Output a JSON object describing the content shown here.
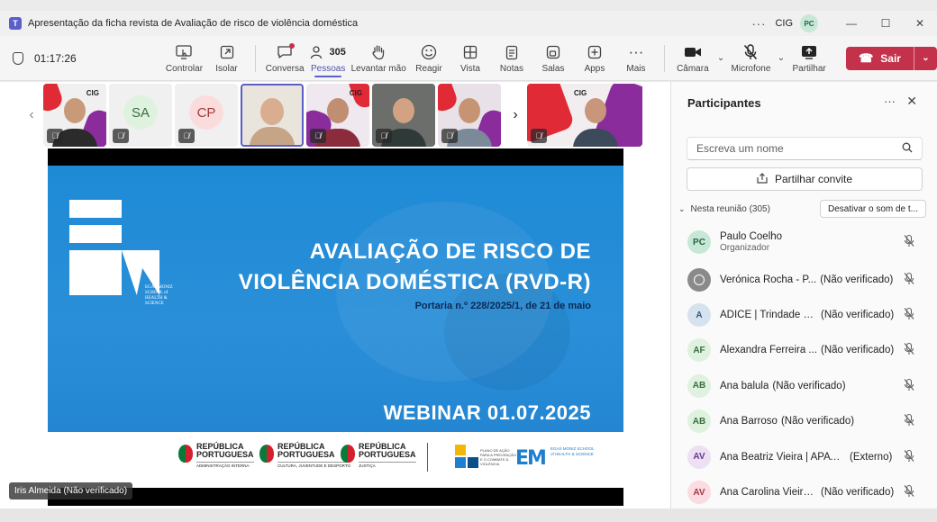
{
  "window": {
    "title": "Apresentação da ficha revista de Avaliação de risco de violência doméstica",
    "org": "CIG",
    "avatar_initials": "PC",
    "more_icon": "ellipsis-icon",
    "controls": [
      "minimize-icon",
      "maximize-icon",
      "close-icon"
    ]
  },
  "toolbar": {
    "timer": "01:17:26",
    "items": [
      {
        "name": "controlar",
        "label": "Controlar",
        "icon": "share-screen-control-icon"
      },
      {
        "name": "isolar",
        "label": "Isolar",
        "icon": "pop-out-icon"
      },
      {
        "name": "conversa",
        "label": "Conversa",
        "icon": "chat-icon"
      },
      {
        "name": "pessoas",
        "label": "Pessoas",
        "icon": "people-icon",
        "count": "305",
        "active": true
      },
      {
        "name": "levantar-mao",
        "label": "Levantar mão",
        "icon": "raise-hand-icon"
      },
      {
        "name": "reagir",
        "label": "Reagir",
        "icon": "smile-icon"
      },
      {
        "name": "vista",
        "label": "Vista",
        "icon": "grid-view-icon"
      },
      {
        "name": "notas",
        "label": "Notas",
        "icon": "notes-icon"
      },
      {
        "name": "salas",
        "label": "Salas",
        "icon": "breakout-rooms-icon"
      },
      {
        "name": "apps",
        "label": "Apps",
        "icon": "apps-plus-icon"
      },
      {
        "name": "mais",
        "label": "Mais",
        "icon": "more-icon"
      }
    ],
    "camera_label": "Câmara",
    "mic_label": "Microfone",
    "share_label": "Partilhar",
    "leave_label": "Sair"
  },
  "strip": {
    "tiles": [
      {
        "type": "video",
        "brand": "CIG",
        "muted": true
      },
      {
        "type": "initials",
        "initials": "SA",
        "bg": "#dff2e0",
        "fg": "#3b6e3f",
        "muted": true
      },
      {
        "type": "initials",
        "initials": "CP",
        "bg": "#fbdcdc",
        "fg": "#a33a3a",
        "muted": true
      },
      {
        "type": "video",
        "selected": true,
        "muted": false
      },
      {
        "type": "video",
        "brand": "CIG",
        "muted": true
      },
      {
        "type": "video",
        "muted": true
      },
      {
        "type": "video",
        "muted": true
      },
      {
        "type": "video",
        "brand": "CIG",
        "muted": true,
        "wide": true
      }
    ]
  },
  "slide": {
    "title_line1": "AVALIAÇÃO DE RISCO DE",
    "title_line2": "VIOLÊNCIA DOMÉSTICA (RVD-R)",
    "subtitle": "Portaria n.º 228/2025/1, de 21 de maio",
    "webinar": "WEBINAR 01.07.2025",
    "logo_school": "EGAS MONIZ SCHOOL of HEALTH & SCIENCE",
    "gov_logos": [
      {
        "name": "REPÚBLICA",
        "name2": "PORTUGUESA",
        "dept": "ADMINISTRAÇÃO INTERNA"
      },
      {
        "name": "REPÚBLICA",
        "name2": "PORTUGUESA",
        "dept": "CULTURA, JUVENTUDE E DESPORTO"
      },
      {
        "name": "REPÚBLICA",
        "name2": "PORTUGUESA",
        "dept": "JUSTIÇA"
      }
    ],
    "plan_logo_text": "PLANO DE AÇÃO PARA A PREVENÇÃO E O COMBATE À VIOLÊNCIA",
    "em_logo": "EM",
    "em_logo_text": "EGAS MONIZ SCHOOL of HEALTH & SCIENCE"
  },
  "speaker_tag": "Iris Almeida (Não verificado)",
  "panel": {
    "title": "Participantes",
    "search_placeholder": "Escreva um nome",
    "invite_label": "Partilhar convite",
    "section_label": "Nesta reunião (305)",
    "mute_all_label": "Desativar o som de t...",
    "organizer": {
      "initials": "PC",
      "name": "Paulo Coelho",
      "role": "Organizador",
      "bg": "#c7e8d6",
      "fg": "#286343"
    },
    "participants": [
      {
        "initials": "",
        "name": "Verónica Rocha - P...",
        "status": "(Não verificado)",
        "generic": true
      },
      {
        "initials": "A",
        "name": "ADICE | Trindade V...",
        "status": "(Não verificado)",
        "bg": "#d6e2ee",
        "fg": "#3a5a7a"
      },
      {
        "initials": "AF",
        "name": "Alexandra Ferreira ...",
        "status": "(Não verificado)",
        "bg": "#dff2e0",
        "fg": "#3b6e3f"
      },
      {
        "initials": "AB",
        "name": "Ana balula",
        "status": "(Não verificado)",
        "bg": "#dff2e0",
        "fg": "#3b6e3f"
      },
      {
        "initials": "AB",
        "name": "Ana Barroso",
        "status": "(Não verificado)",
        "bg": "#dff2e0",
        "fg": "#3b6e3f"
      },
      {
        "initials": "AV",
        "name": "Ana Beatriz Vieira | APAV |...",
        "status": "(Externo)",
        "bg": "#ece0f2",
        "fg": "#6a3a8a"
      },
      {
        "initials": "AV",
        "name": "Ana Carolina Vieira...",
        "status": "(Não verificado)",
        "bg": "#fbdce0",
        "fg": "#a33a4a"
      }
    ]
  }
}
